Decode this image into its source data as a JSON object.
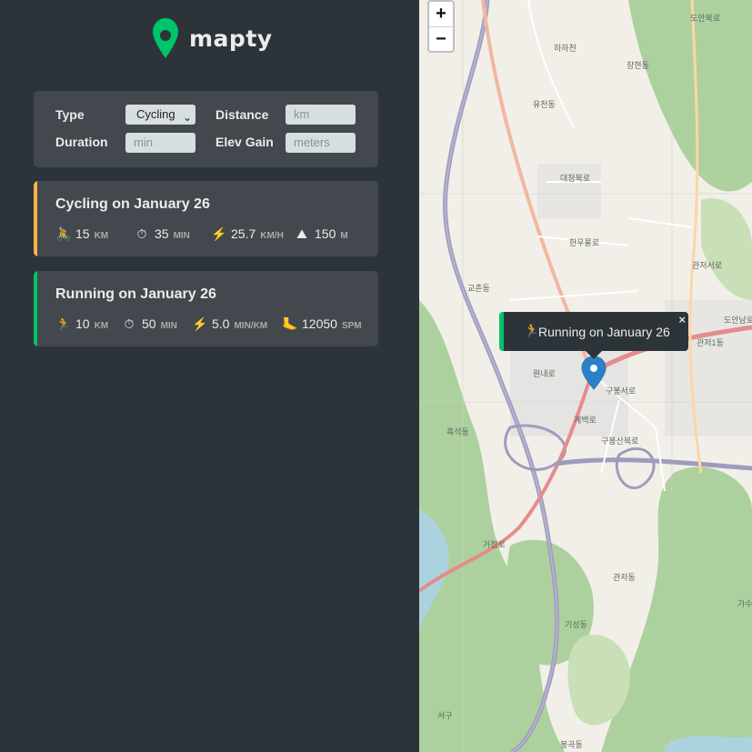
{
  "app": {
    "logo_text": "mapty",
    "brand_color": "#00c46a"
  },
  "form": {
    "type_label": "Type",
    "type_value": "Cycling",
    "distance_label": "Distance",
    "distance_placeholder": "km",
    "duration_label": "Duration",
    "duration_placeholder": "min",
    "elev_label": "Elev Gain",
    "elev_placeholder": "meters"
  },
  "workouts": [
    {
      "title": "Cycling on January 26",
      "color": "#ffb545",
      "details": [
        {
          "icon": "cyclist-icon",
          "glyph": "🚴",
          "value": "15",
          "unit": "km"
        },
        {
          "icon": "stopwatch-icon",
          "glyph": "⏱",
          "value": "35",
          "unit": "min"
        },
        {
          "icon": "lightning-icon",
          "glyph": "⚡",
          "value": "25.7",
          "unit": "km/h"
        },
        {
          "icon": "mountain-icon",
          "glyph": "⛰",
          "value": "150",
          "unit": "m"
        }
      ]
    },
    {
      "title": "Running on January 26",
      "color": "#00c46a",
      "details": [
        {
          "icon": "runner-icon",
          "glyph": "🏃",
          "value": "10",
          "unit": "km"
        },
        {
          "icon": "stopwatch-icon",
          "glyph": "⏱",
          "value": "50",
          "unit": "min"
        },
        {
          "icon": "lightning-icon",
          "glyph": "⚡",
          "value": "5.0",
          "unit": "min/km"
        },
        {
          "icon": "footprint-icon",
          "glyph": "🦶",
          "value": "12050",
          "unit": "spm"
        }
      ]
    }
  ],
  "map": {
    "zoom_in": "+",
    "zoom_out": "−",
    "popup_text": "Running on January 26",
    "popup_close": "×",
    "popup_glyph": "🏃",
    "labels": [
      "하하천",
      "장현동",
      "유천동",
      "대청북로",
      "한우물로",
      "교촌동",
      "원내로",
      "구봉서로",
      "구봉산북로",
      "관저서로",
      "관저동",
      "도안북로",
      "도안남로",
      "거점로",
      "계백로",
      "관저1동",
      "가수원",
      "흑석동",
      "기성동",
      "서구",
      "봉곡동"
    ]
  }
}
